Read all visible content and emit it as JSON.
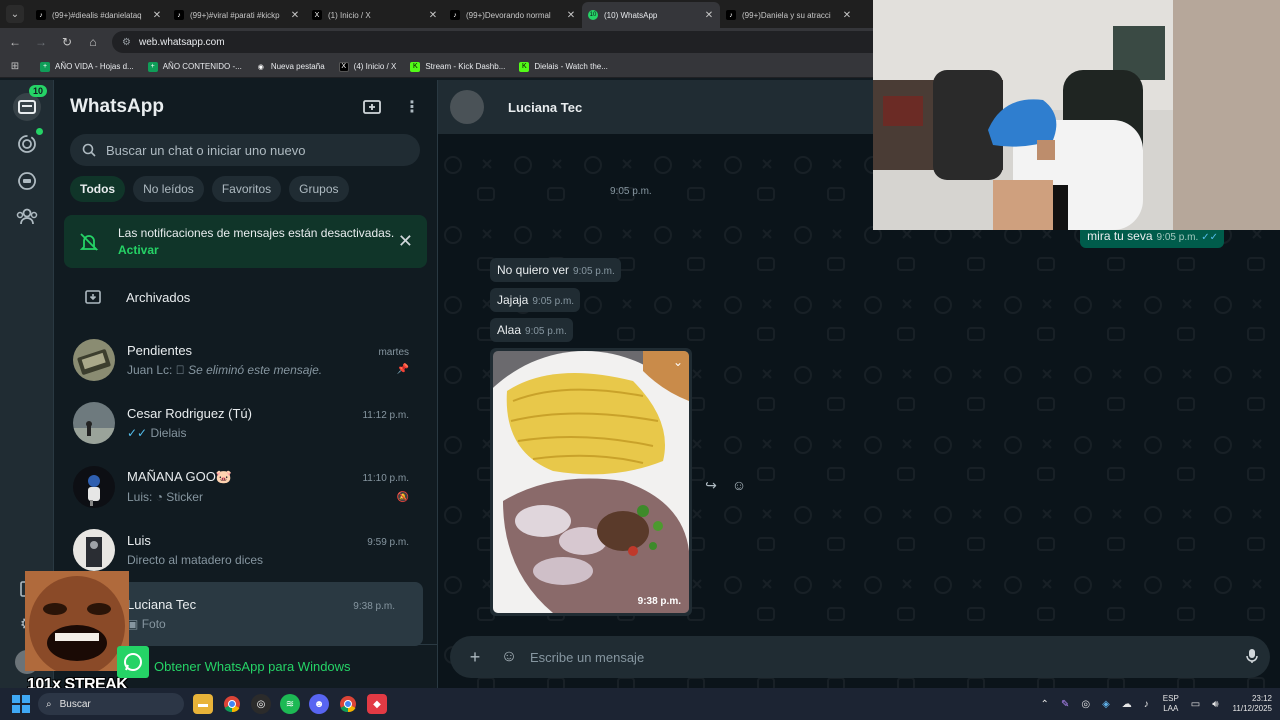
{
  "browser": {
    "tabs": [
      {
        "title": "(99+)#diealis #danielataq",
        "icon": "tiktok"
      },
      {
        "title": "(99+)#viral #parati #kickp",
        "icon": "tiktok"
      },
      {
        "title": "(1) Inicio / X",
        "icon": "x"
      },
      {
        "title": "(99+)Devorando normal",
        "icon": "tiktok"
      },
      {
        "title": "(10) WhatsApp",
        "icon": "whatsapp",
        "active": true
      },
      {
        "title": "(99+)Daniela y su atracci",
        "icon": "tiktok"
      }
    ],
    "url": "web.whatsapp.com",
    "bookmarks": [
      {
        "label": "AÑO VIDA - Hojas d...",
        "color": "#0f9d58"
      },
      {
        "label": "AÑO CONTENIDO -...",
        "color": "#0f9d58"
      },
      {
        "label": "Nueva pestaña",
        "color": "#8ab4f8"
      },
      {
        "label": "(4) Inicio / X",
        "color": "#000000"
      },
      {
        "label": "Stream - Kick Dashb...",
        "color": "#53fc18"
      },
      {
        "label": "Dielais - Watch the...",
        "color": "#53fc18"
      }
    ]
  },
  "rail": {
    "chats_badge": "10"
  },
  "sidebar": {
    "title": "WhatsApp",
    "search_placeholder": "Buscar un chat o iniciar uno nuevo",
    "filters": [
      "Todos",
      "No leídos",
      "Favoritos",
      "Grupos"
    ],
    "notification": {
      "text": "Las notificaciones de mensajes están desactivadas.",
      "action": "Activar"
    },
    "archived_label": "Archivados",
    "chats": [
      {
        "name": "Pendientes",
        "time": "martes",
        "preview_sender": "Juan Lc:",
        "preview": "Se eliminó este mensaje.",
        "flag": "pin"
      },
      {
        "name": "Cesar Rodriguez (Tú)",
        "time": "11:12 p.m.",
        "preview_sender": "",
        "preview": "Dielais",
        "flag": ""
      },
      {
        "name": "MAÑANA GOO🐷",
        "time": "11:10 p.m.",
        "preview_sender": "Luis:",
        "preview": "Sticker",
        "flag": "muted"
      },
      {
        "name": "Luis",
        "time": "9:59 p.m.",
        "preview_sender": "",
        "preview": "Directo al matadero dices",
        "flag": ""
      },
      {
        "name": "Luciana Tec",
        "time": "9:38 p.m.",
        "preview_sender": "",
        "preview": "Foto",
        "flag": "",
        "selected": true
      }
    ],
    "get_windows": "Obtener WhatsApp para Windows"
  },
  "conversation": {
    "contact": "Luciana Tec",
    "messages": [
      {
        "dir": "out",
        "text": "mira tu seva",
        "time": "9:05 p.m."
      },
      {
        "dir": "in",
        "text": "No quiero ver",
        "time": "9:05 p.m."
      },
      {
        "dir": "in",
        "text": "Jajaja",
        "time": "9:05 p.m."
      },
      {
        "dir": "in",
        "text": "Alaa",
        "time": "9:05 p.m."
      }
    ],
    "orphan_time": "9:05 p.m.",
    "photo_time": "9:38 p.m.",
    "composer_placeholder": "Escribe un mensaje"
  },
  "overlay": {
    "streak": "101x STREAK"
  },
  "taskbar": {
    "search": "Buscar",
    "lang": [
      "ESP",
      "LAA"
    ],
    "time": "23:12",
    "date": "11/12/2025"
  }
}
